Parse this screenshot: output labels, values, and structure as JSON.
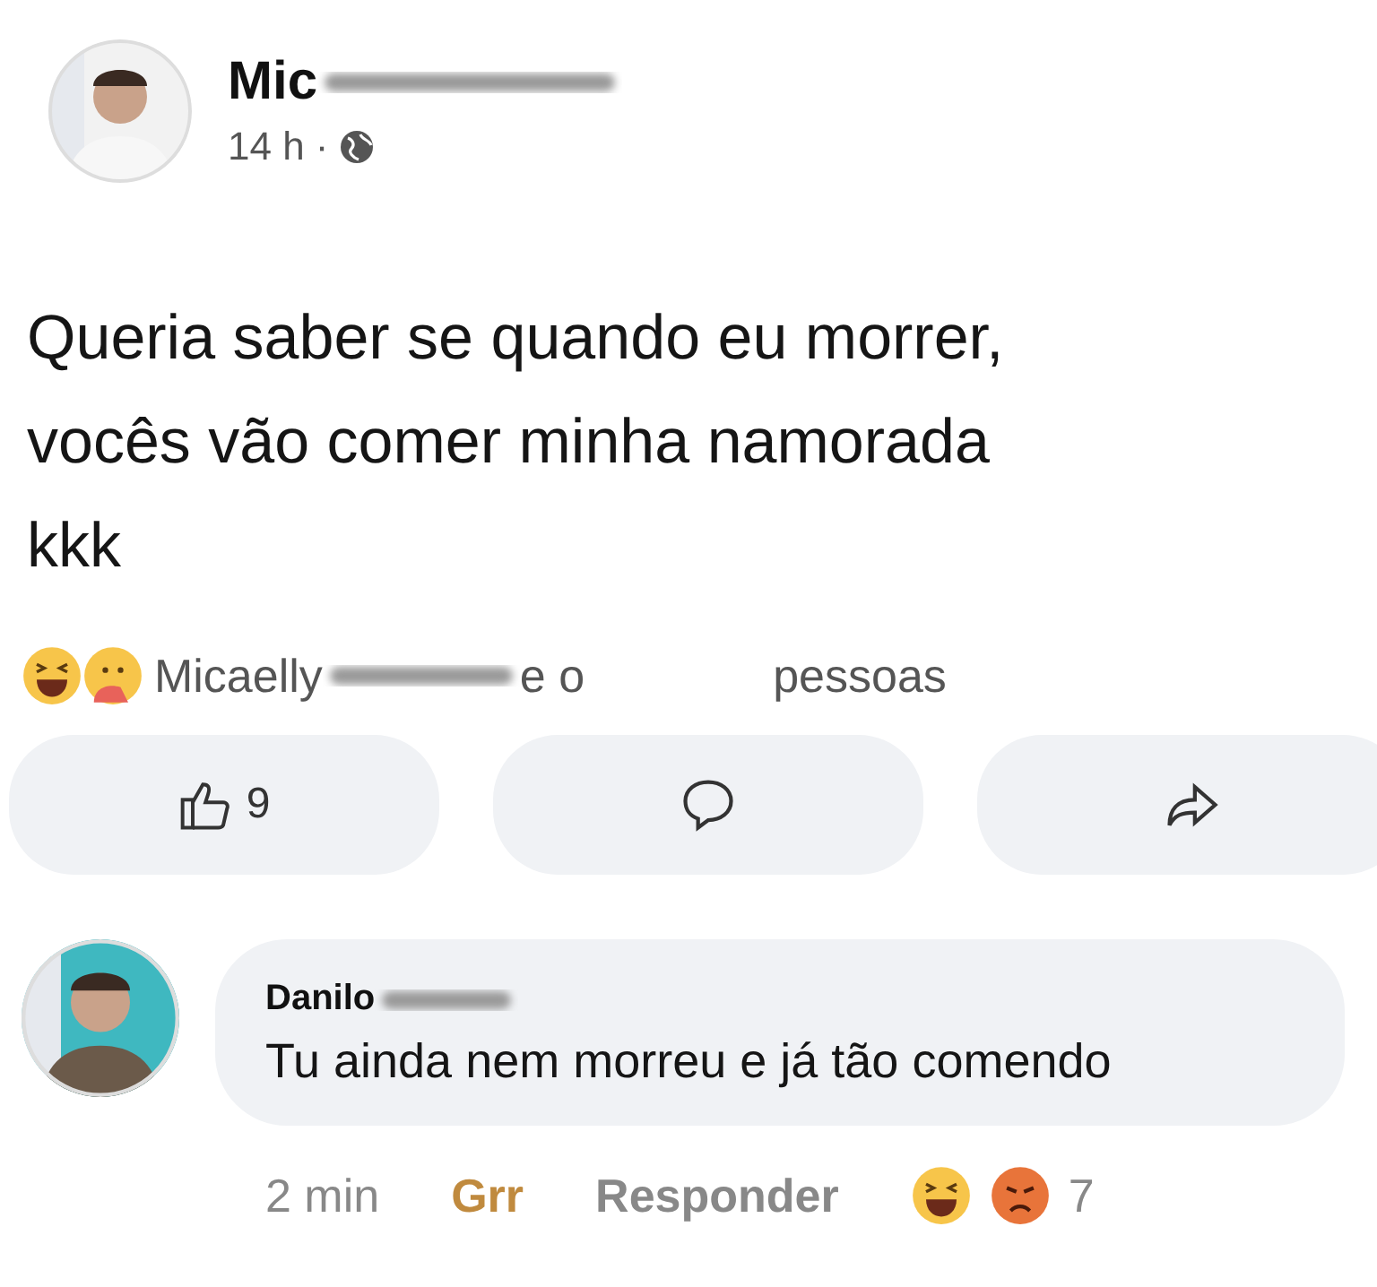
{
  "post": {
    "author": "Mic",
    "time": "14 h",
    "separator": "·",
    "text": "Queria saber se quando eu morrer,\nvocês vão comer minha namorada\nkkk"
  },
  "reactions_summary": {
    "icons": [
      {
        "kind": "haha"
      },
      {
        "kind": "care"
      }
    ],
    "name": "Micaelly",
    "joiner": "e o",
    "suffix": "pessoas"
  },
  "actions": [
    {
      "kind": "like",
      "count": "9"
    },
    {
      "kind": "comment"
    },
    {
      "kind": "share"
    }
  ],
  "comment": {
    "author": "Danilo",
    "text": "Tu ainda nem morreu e já tão comendo",
    "time": "2 min",
    "reaction_label": "Grr",
    "reacted": true,
    "reply": "Responder",
    "reaction_icons": [
      {
        "kind": "haha"
      },
      {
        "kind": "angry"
      }
    ],
    "reaction_count": "7"
  }
}
